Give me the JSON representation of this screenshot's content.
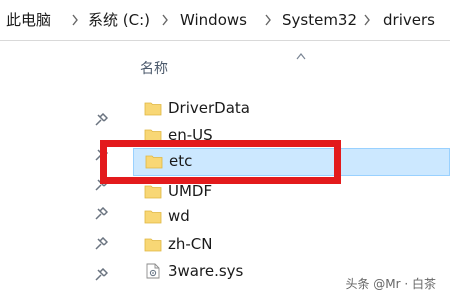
{
  "breadcrumb": {
    "items": [
      "此电脑",
      "系统 (C:)",
      "Windows",
      "System32",
      "drivers"
    ]
  },
  "column_header": {
    "name_label": "名称"
  },
  "files": [
    {
      "label": "DriverData",
      "type": "folder"
    },
    {
      "label": "en-US",
      "type": "folder"
    },
    {
      "label": "etc",
      "type": "folder",
      "selected": true
    },
    {
      "label": "UMDF",
      "type": "folder"
    },
    {
      "label": "wd",
      "type": "folder"
    },
    {
      "label": "zh-CN",
      "type": "folder"
    },
    {
      "label": "3ware.sys",
      "type": "sys-file"
    }
  ],
  "colors": {
    "selection_bg": "#cce8ff",
    "selection_border": "#99d1ff",
    "annotation_red": "#e31a1c",
    "folder_yellow": "#f8d775"
  },
  "watermark": {
    "text": "头条 @Mr · 白茶"
  }
}
